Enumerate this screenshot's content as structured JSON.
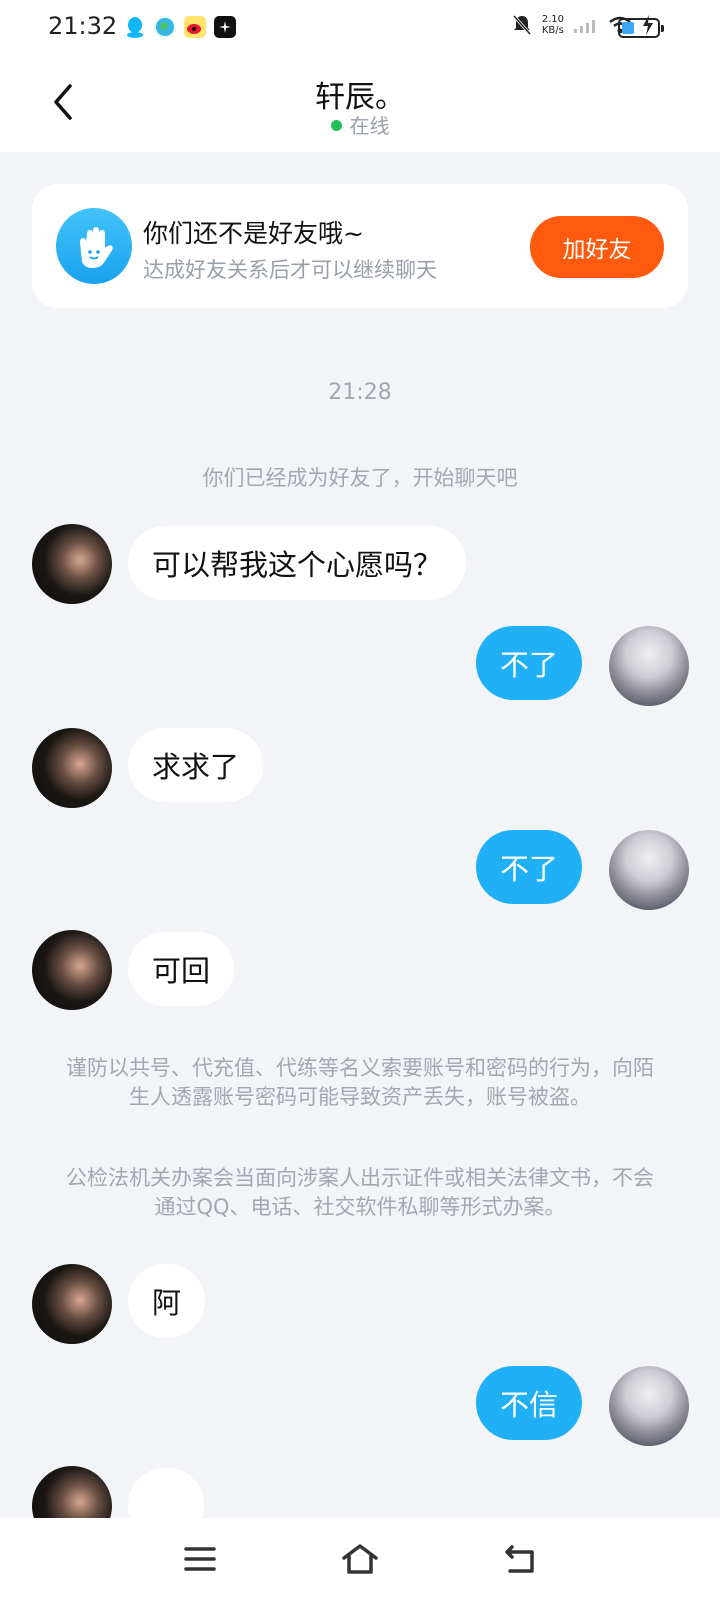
{
  "status_bar": {
    "time": "21:32",
    "net_speed_value": "2.10",
    "net_speed_unit": "KB/s",
    "battery_level": 0.3,
    "app_icons": [
      "qq-icon",
      "browser-icon",
      "weibo-icon",
      "sparkle-app-icon"
    ]
  },
  "header": {
    "title": "轩辰。",
    "status": "在线"
  },
  "friend_card": {
    "title": "你们还不是好友哦~",
    "subtitle": "达成好友关系后才可以继续聊天",
    "button": "加好友"
  },
  "chat": {
    "timestamp": "21:28",
    "system_note": "你们已经成为好友了，开始聊天吧",
    "messages": [
      {
        "side": "left",
        "text": "可以帮我这个心愿吗？"
      },
      {
        "side": "right",
        "text": "不了"
      },
      {
        "side": "left",
        "text": "求求了"
      },
      {
        "side": "right",
        "text": "不了"
      },
      {
        "side": "left",
        "text": "可回"
      },
      {
        "side": "left",
        "text": "阿"
      },
      {
        "side": "right",
        "text": "不信"
      }
    ],
    "warning_1": "谨防以共号、代充值、代练等名义索要账号和密码的行为，向陌生人透露账号密码可能导致资产丢失，账号被盗。",
    "warning_2": "公检法机关办案会当面向涉案人出示证件或相关法律文书，不会通过QQ、电话、社交软件私聊等形式办案。"
  },
  "colors": {
    "accent_blue": "#1fb0f8",
    "add_button": "#ff5a0e",
    "online_dot": "#21c15a",
    "background": "#f2f4f7"
  }
}
